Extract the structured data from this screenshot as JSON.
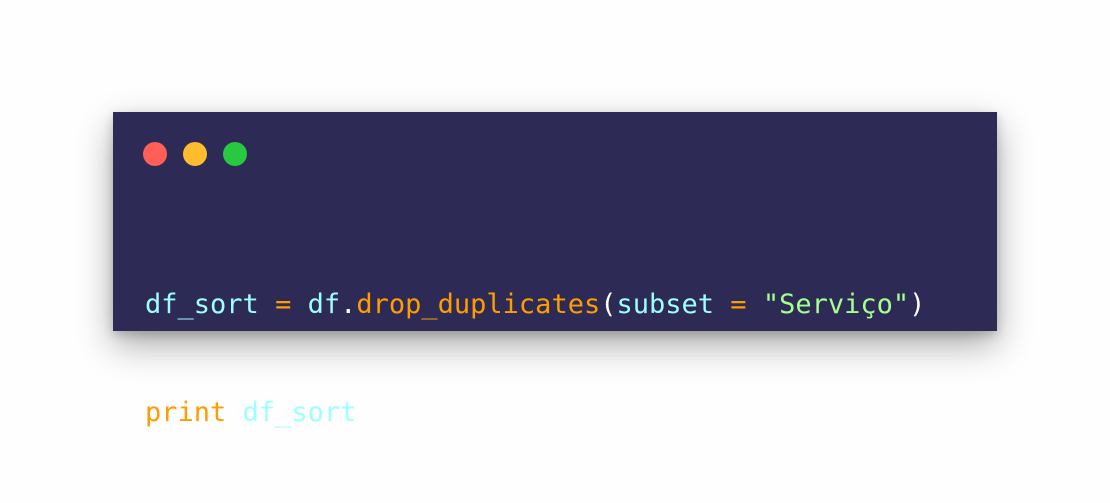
{
  "window": {
    "traffic_lights": {
      "close_color": "#ff5f57",
      "minimize_color": "#febc2e",
      "maximize_color": "#28c840"
    },
    "background": "#2d2a55"
  },
  "code": {
    "line1": {
      "var1": "df_sort",
      "eq": "=",
      "obj": "df",
      "dot": ".",
      "method": "drop_duplicates",
      "lparen": "(",
      "param": "subset",
      "eq2": "=",
      "string": "\"Serviço\"",
      "rparen": ")"
    },
    "line2": {
      "fn": "print",
      "lparen": "(",
      "arg": "df_sort",
      "rparen": ")"
    }
  },
  "colors": {
    "variable": "#9effff",
    "operator": "#ff9d00",
    "function": "#ff9d00",
    "string": "#a5ff90",
    "punctuation": "#ffffff"
  }
}
